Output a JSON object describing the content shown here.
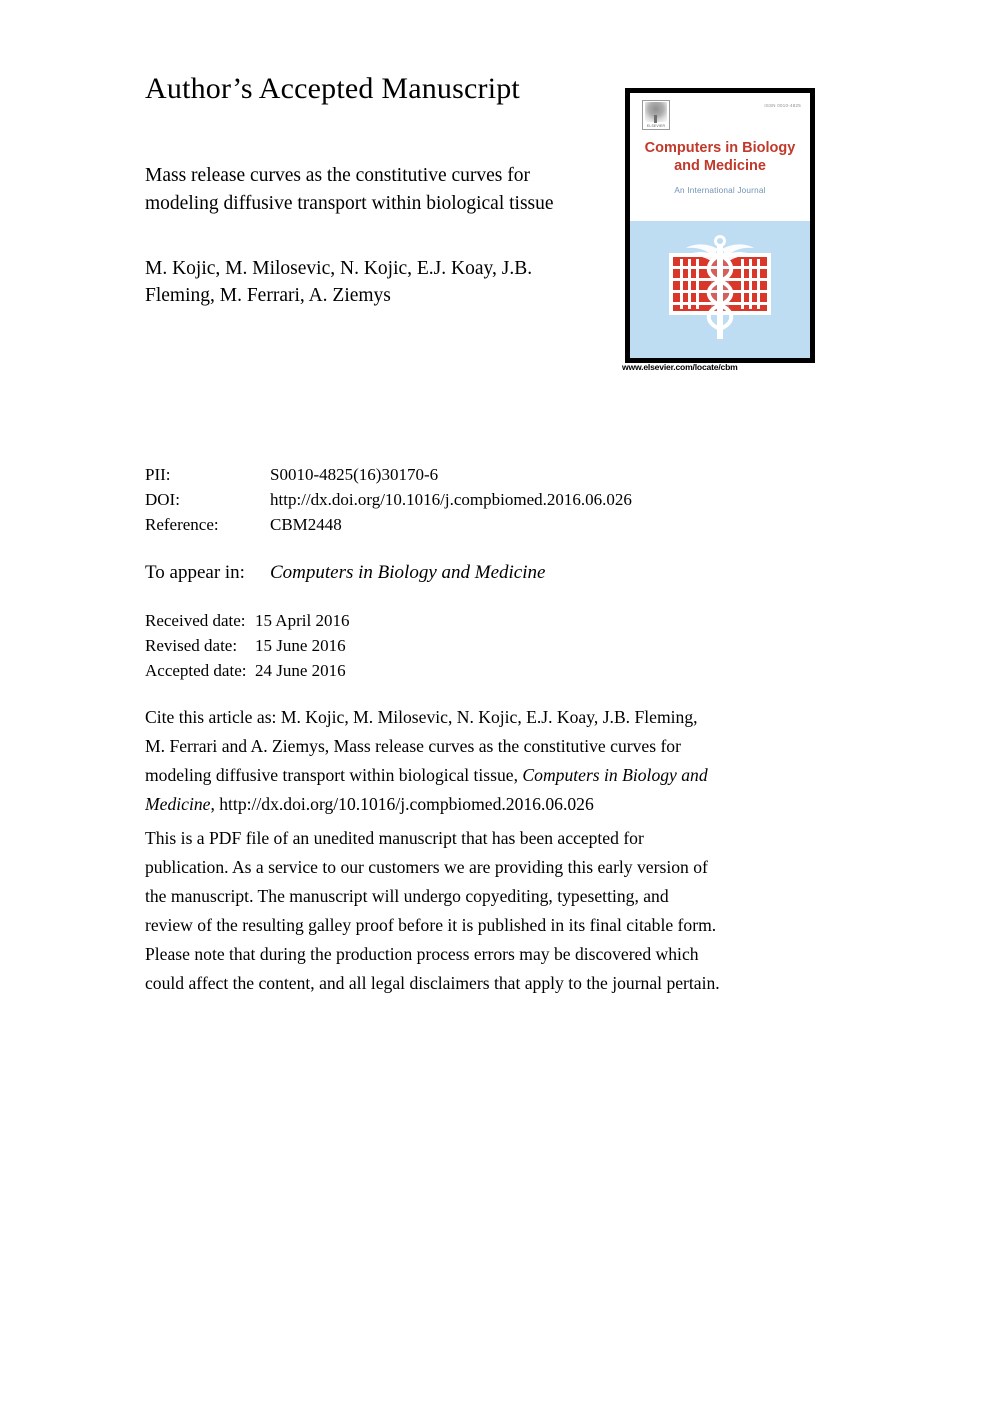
{
  "header": {
    "accepted_manuscript_label": "Author’s Accepted Manuscript"
  },
  "article": {
    "title_line1": "Mass release curves as the constitutive curves for",
    "title_line2": "modeling diffusive transport within biological tissue",
    "authors_line1": "M. Kojic, M. Milosevic, N. Kojic, E.J. Koay, J.B.",
    "authors_line2": "Fleming, M. Ferrari, A. Ziemys"
  },
  "cover": {
    "publisher_wordmark": "ELSEVIER",
    "issn_text": "ISSN 0010-4825",
    "journal_title_line1": "Computers in Biology",
    "journal_title_line2": "and Medicine",
    "subtitle": "An International Journal",
    "url": "www.elsevier.com/locate/cbm",
    "title_color": "#C0392B",
    "subtitle_color": "#6f93b5",
    "panel_color": "#bedcf2",
    "emblem_color": "#d9372a"
  },
  "metadata": {
    "rows": [
      {
        "label": "PII:",
        "value": "S0010-4825(16)30170-6"
      },
      {
        "label": "DOI:",
        "value": "http://dx.doi.org/10.1016/j.compbiomed.2016.06.026"
      },
      {
        "label": "Reference:",
        "value": "CBM2448"
      }
    ],
    "appear_label": "To appear in:",
    "appear_value": "Computers in Biology and Medicine",
    "dates": [
      {
        "label": "Received date:",
        "value": "15 April 2016"
      },
      {
        "label": "Revised date:",
        "value": "15 June 2016"
      },
      {
        "label": "Accepted date:",
        "value": "24 June 2016"
      }
    ]
  },
  "citation": {
    "line1": "Cite this article as: M. Kojic, M. Milosevic, N. Kojic, E.J. Koay, J.B. Fleming,",
    "line2": "M. Ferrari and A. Ziemys, Mass release curves as the constitutive curves for",
    "line3_plain": "modeling diffusive transport within biological tissue, ",
    "line3_italic": "Computers in Biology and",
    "line4_italic": "Medicine",
    "line4_plain": ", http://dx.doi.org/10.1016/j.compbiomed.2016.06.026"
  },
  "disclaimer": {
    "line1": "This is a PDF file of an unedited manuscript that has been accepted for",
    "line2": "publication. As a service to our customers we are providing this early version of",
    "line3": "the manuscript. The manuscript will undergo copyediting, typesetting, and",
    "line4": "review of the resulting galley proof before it is published in its final citable form.",
    "line5": "Please note that during the production process errors may be discovered which",
    "line6": "could affect the content, and all legal disclaimers that apply to the journal pertain."
  }
}
